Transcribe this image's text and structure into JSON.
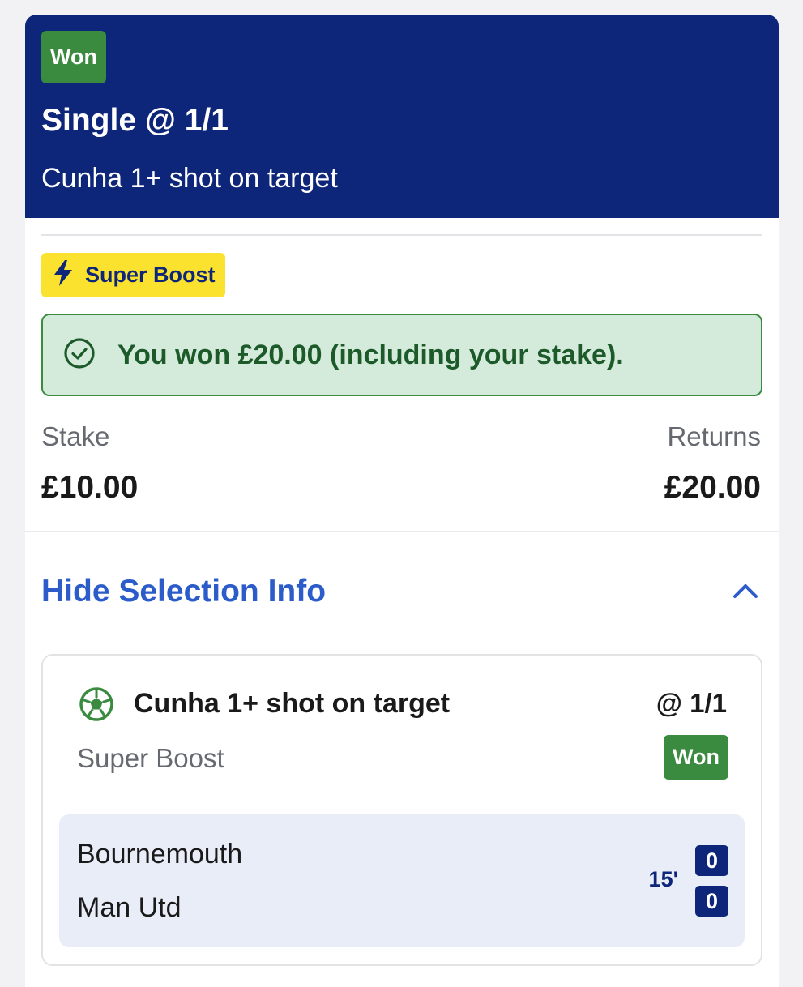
{
  "bet": {
    "status": "Won",
    "title": "Single @ 1/1",
    "subtitle": "Cunha 1+ shot on target"
  },
  "boost": {
    "label": "Super Boost",
    "icon": "lightning-icon"
  },
  "win_message": {
    "text": "You won £20.00 (including your stake).",
    "icon": "check-circle-icon"
  },
  "summary": {
    "stake_label": "Stake",
    "stake_value": "£10.00",
    "returns_label": "Returns",
    "returns_value": "£20.00"
  },
  "selection_toggle": {
    "label": "Hide Selection Info",
    "icon": "chevron-up-icon"
  },
  "selection": {
    "icon": "football-icon",
    "name": "Cunha 1+ shot on target",
    "odds": "@ 1/1",
    "type": "Super Boost",
    "status": "Won",
    "match": {
      "home_team": "Bournemouth",
      "away_team": "Man Utd",
      "minute": "15'",
      "home_score": "0",
      "away_score": "0"
    }
  },
  "colors": {
    "header_bg": "#0d2679",
    "won_green": "#3a8a3f",
    "boost_yellow": "#fbe22e",
    "link_blue": "#2b5cc9",
    "success_bg": "#d4ebdc"
  }
}
